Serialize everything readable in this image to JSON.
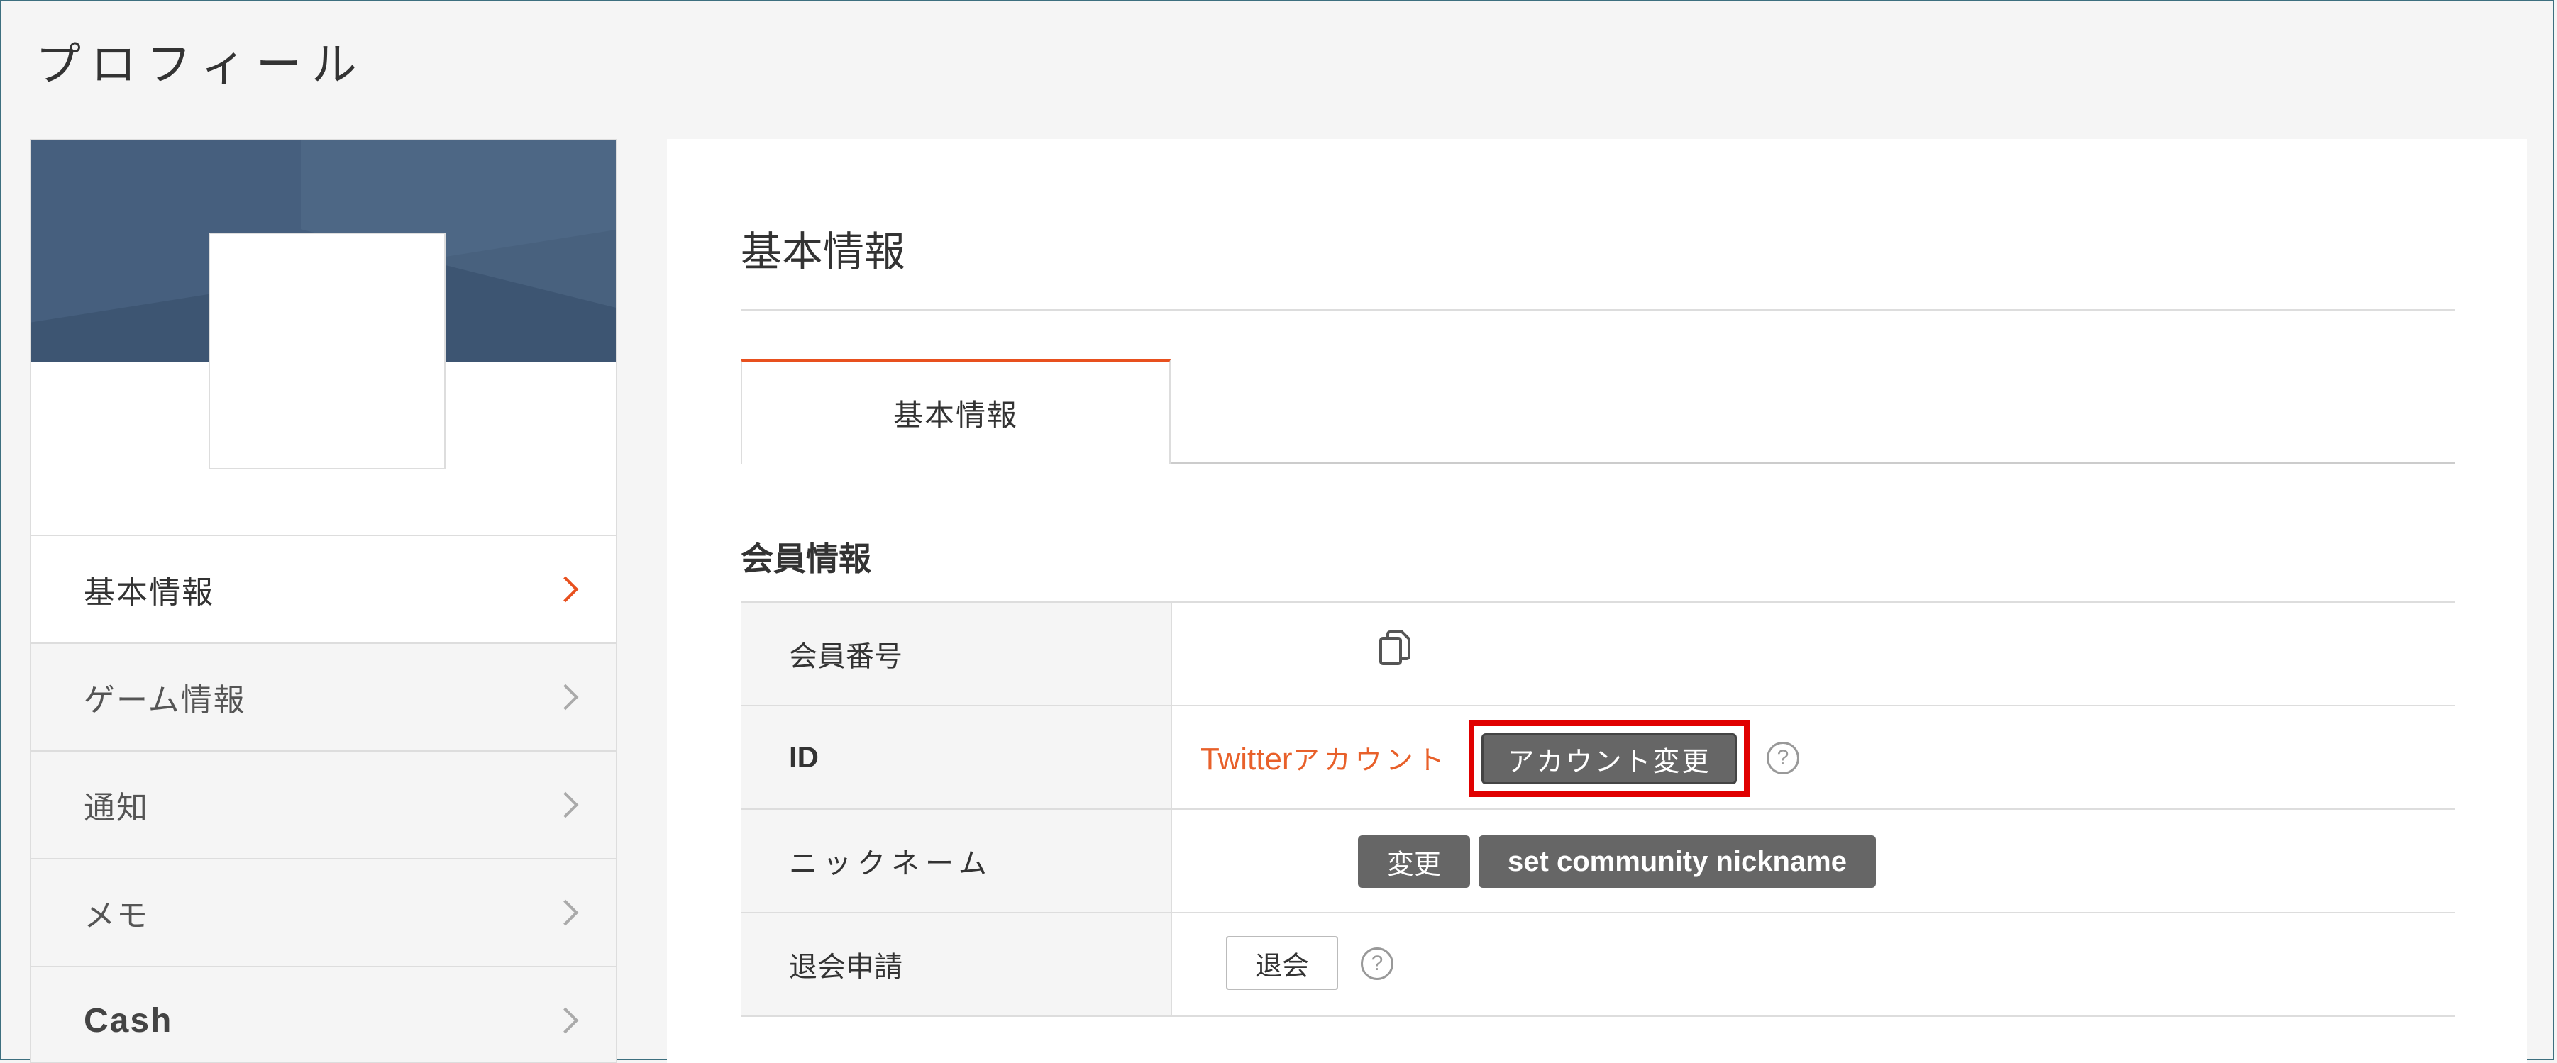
{
  "page": {
    "title": "プロフィール"
  },
  "sidebar": {
    "items": [
      {
        "label": "基本情報",
        "active": true
      },
      {
        "label": "ゲーム情報",
        "active": false
      },
      {
        "label": "通知",
        "active": false
      },
      {
        "label": "メモ",
        "active": false
      },
      {
        "label": "Cash",
        "active": false
      }
    ]
  },
  "main": {
    "section_title": "基本情報",
    "tab_label": "基本情報",
    "subsection_title": "会員情報",
    "rows": {
      "member_number": {
        "label": "会員番号"
      },
      "id": {
        "label": "ID",
        "value_twitter": "Twitter",
        "value_account": "アカウント",
        "button_label": "アカウント変更"
      },
      "nickname": {
        "label": "ニックネーム",
        "change_label": "変更",
        "community_label": "set community nickname"
      },
      "withdraw": {
        "label": "退会申請",
        "button_label": "退会"
      }
    },
    "help_symbol": "?"
  },
  "colors": {
    "accent": "#e8501e",
    "banner": "#3d5572",
    "highlight": "#e00000",
    "button_dark": "#666666"
  }
}
